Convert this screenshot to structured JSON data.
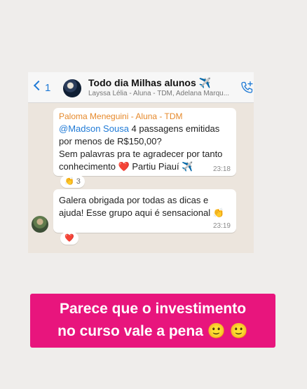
{
  "header": {
    "back_count": "1",
    "group_name": "Todo dia Milhas alunos",
    "group_emoji": "✈️",
    "members": "Layssa Lélia - Aluna - TDM, Adelana Marqu..."
  },
  "messages": [
    {
      "sender": "Paloma Meneguini - Aluna - TDM",
      "mention": "@Madson Sousa",
      "line1_rest": " 4 passagens emitidas",
      "line2": "por menos de R$150,00?",
      "line3": "Sem palavras pra te agradecer por tanto",
      "line4_text": "conhecimento ",
      "line4_heart": "❤️",
      "line4_text2": " Partiu Piauí ",
      "line4_plane": "✈️",
      "time": "23:18",
      "reaction_emoji": "👏",
      "reaction_count": "3"
    },
    {
      "line1": "Galera obrigada por todas as dicas e",
      "line2": "ajuda! Esse grupo aqui é sensacional ",
      "line2_emoji": "👏",
      "time": "23:19",
      "reaction_emoji": "❤️"
    }
  ],
  "banner": {
    "line1": "Parece que o investimento",
    "line2": "no curso vale a pena ",
    "emoji": "🙂 🙂"
  },
  "colors": {
    "banner_bg": "#e8157d",
    "sender_name": "#e6892b",
    "mention": "#1f7ad6",
    "chat_bg": "#ece5dd"
  }
}
